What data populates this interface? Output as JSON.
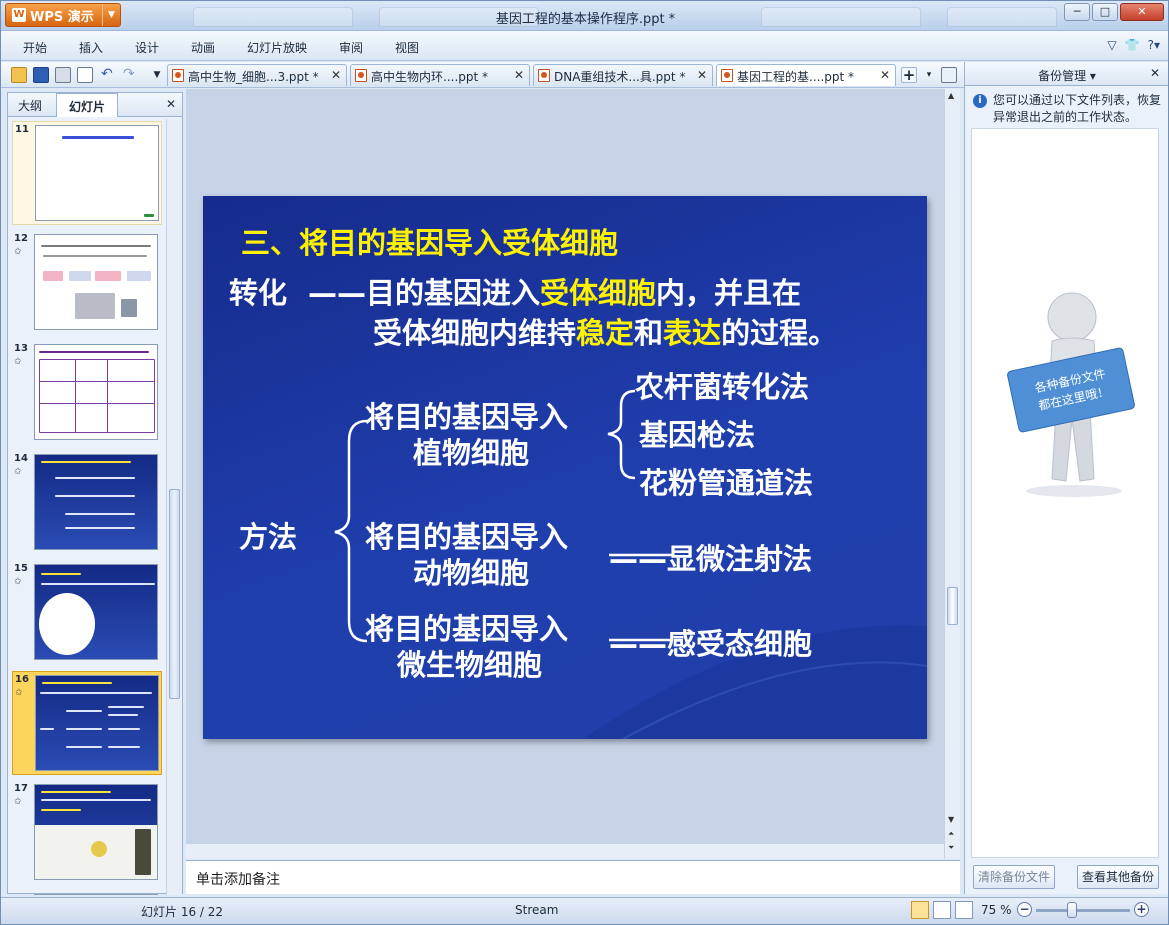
{
  "window": {
    "app_name": "WPS 演示",
    "title": "基因工程的基本操作程序.ppt *",
    "min": "─",
    "max": "□",
    "close": "✕"
  },
  "menu": [
    "开始",
    "插入",
    "设计",
    "动画",
    "幻灯片放映",
    "审阅",
    "视图"
  ],
  "doc_tabs": [
    {
      "label": "高中生物_细胞...3.ppt *",
      "close": "✕"
    },
    {
      "label": "高中生物内环....ppt *",
      "close": "✕"
    },
    {
      "label": "DNA重组技术...具.ppt *",
      "close": "✕"
    },
    {
      "label": "基因工程的基....ppt *",
      "close": "✕"
    }
  ],
  "left_pane": {
    "tab_outline": "大纲",
    "tab_slides": "幻灯片",
    "close": "✕",
    "thumbs": [
      {
        "num": "11",
        "star": ""
      },
      {
        "num": "12",
        "star": "✩"
      },
      {
        "num": "13",
        "star": "✩"
      },
      {
        "num": "14",
        "star": "✩"
      },
      {
        "num": "15",
        "star": "✩"
      },
      {
        "num": "16",
        "star": "✩"
      },
      {
        "num": "17",
        "star": "✩"
      }
    ]
  },
  "slide": {
    "heading": "三、将目的基因导入受体细胞",
    "def_term": "转化",
    "def_line1_a": "——目的基因进入",
    "def_line1_b": "受体细胞",
    "def_line1_c": "内，并且在",
    "def_line2_a": "受体细胞内维持",
    "def_line2_b": "稳定",
    "def_line2_c": "和",
    "def_line2_d": "表达",
    "def_line2_e": "的过程。",
    "method_label": "方法",
    "plant_1": "将目的基因导入",
    "plant_2": "植物细胞",
    "plant_methods": [
      "农杆菌转化法",
      "基因枪法",
      "花粉管通道法"
    ],
    "animal_1": "将目的基因导入",
    "animal_2": "动物细胞",
    "animal_method": "——显微注射法",
    "microbe_1": "将目的基因导入",
    "microbe_2": "微生物细胞",
    "microbe_method": "——感受态细胞",
    "colors": {
      "background": "#1f3fae",
      "text": "#ffffff",
      "highlight": "#fff200"
    }
  },
  "notes_placeholder": "单击添加备注",
  "backup": {
    "title": "备份管理",
    "dropdown": "▾",
    "close": "✕",
    "info": "您可以通过以下文件列表，恢复异常退出之前的工作状态。",
    "sign_line1": "各种备份文件",
    "sign_line2": "都在这里哦！",
    "btn_clear": "清除备份文件",
    "btn_view": "查看其他备份"
  },
  "status": {
    "slide_pos": "幻灯片 16 / 22",
    "theme": "Stream",
    "zoom": "75 %",
    "zoom_minus": "−",
    "zoom_plus": "+"
  }
}
